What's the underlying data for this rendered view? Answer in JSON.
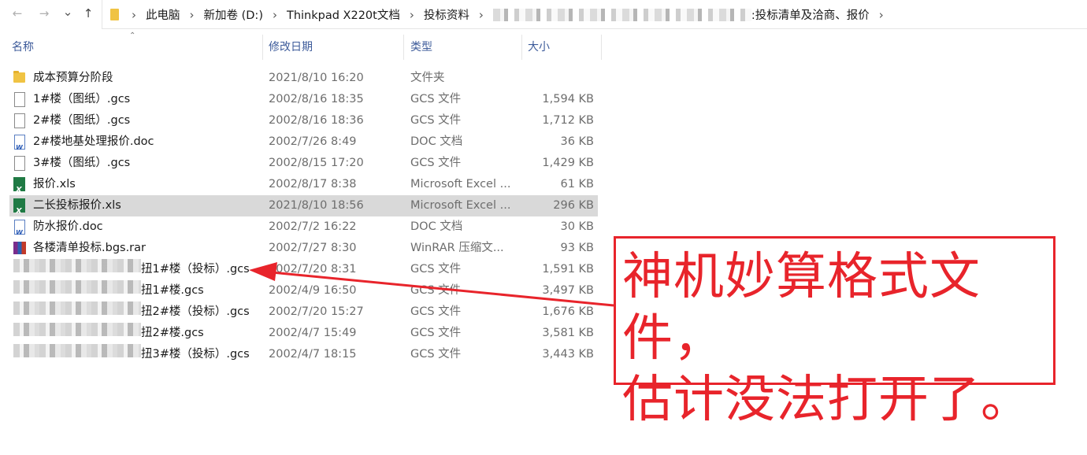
{
  "nav": {
    "back_icon": "←",
    "forward_icon": "→",
    "recent_icon": "⌄",
    "up_icon": "↑"
  },
  "address": {
    "crumbs": [
      "此电脑",
      "新加卷 (D:)",
      "Thinkpad X220t文档",
      "投标资料"
    ],
    "last_crumb": ":投标清单及洽商、报价",
    "separator": "›"
  },
  "columns": {
    "name": "名称",
    "date": "修改日期",
    "type": "类型",
    "size": "大小"
  },
  "files": [
    {
      "icon": "folder-icon",
      "name": "成本预算分阶段",
      "date": "2021/8/10 16:20",
      "type": "文件夹",
      "size": ""
    },
    {
      "icon": "file-icon",
      "name": "1#楼（图纸）.gcs",
      "date": "2002/8/16 18:35",
      "type": "GCS 文件",
      "size": "1,594 KB"
    },
    {
      "icon": "file-icon",
      "name": "2#楼（图纸）.gcs",
      "date": "2002/8/16 18:36",
      "type": "GCS 文件",
      "size": "1,712 KB"
    },
    {
      "icon": "word-icon",
      "name": "2#楼地基处理报价.doc",
      "date": "2002/7/26 8:49",
      "type": "DOC 文档",
      "size": "36 KB"
    },
    {
      "icon": "file-icon",
      "name": "3#楼（图纸）.gcs",
      "date": "2002/8/15 17:20",
      "type": "GCS 文件",
      "size": "1,429 KB"
    },
    {
      "icon": "excel-icon",
      "name": "报价.xls",
      "date": "2002/8/17 8:38",
      "type": "Microsoft Excel ...",
      "size": "61 KB"
    },
    {
      "icon": "excel-icon",
      "name": "二长投标报价.xls",
      "date": "2021/8/10 18:56",
      "type": "Microsoft Excel ...",
      "size": "296 KB",
      "selected": true
    },
    {
      "icon": "word-icon",
      "name": "防水报价.doc",
      "date": "2002/7/2 16:22",
      "type": "DOC 文档",
      "size": "30 KB"
    },
    {
      "icon": "rar-icon",
      "name": "各楼清单投标.bgs.rar",
      "date": "2002/7/27 8:30",
      "type": "WinRAR 压缩文...",
      "size": "93 KB"
    },
    {
      "icon": "blurred",
      "name": "扭1#楼（投标）.gcs",
      "date": "2002/7/20 8:31",
      "type": "GCS 文件",
      "size": "1,591 KB"
    },
    {
      "icon": "blurred",
      "name": "扭1#楼.gcs",
      "date": "2002/4/9 16:50",
      "type": "GCS 文件",
      "size": "3,497 KB"
    },
    {
      "icon": "blurred",
      "name": "扭2#楼（投标）.gcs",
      "date": "2002/7/20 15:27",
      "type": "GCS 文件",
      "size": "1,676 KB"
    },
    {
      "icon": "blurred",
      "name": "扭2#楼.gcs",
      "date": "2002/4/7 15:49",
      "type": "GCS 文件",
      "size": "3,581 KB"
    },
    {
      "icon": "blurred",
      "name": "扭3#楼（投标）.gcs",
      "date": "2002/4/7 18:15",
      "type": "GCS 文件",
      "size": "3,443 KB"
    }
  ],
  "annotation": {
    "text": "神机妙算格式文件，\n估计没法打开了。",
    "color": "#e8242b"
  },
  "colors": {
    "selected_row": "#d9d9d9",
    "header_text": "#3d5b9a",
    "folder": "#f0c343"
  }
}
